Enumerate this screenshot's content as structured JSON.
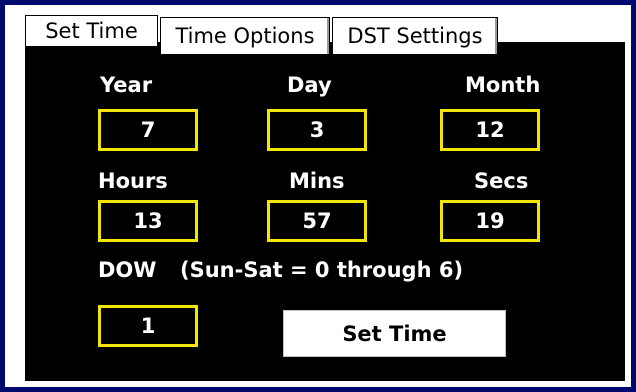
{
  "tabs": [
    {
      "label": "Set Time",
      "active": true
    },
    {
      "label": "Time Options",
      "active": false
    },
    {
      "label": "DST Settings",
      "active": false
    }
  ],
  "date": {
    "year_label": "Year",
    "year_value": "7",
    "day_label": "Day",
    "day_value": "3",
    "month_label": "Month",
    "month_value": "12"
  },
  "time": {
    "hours_label": "Hours",
    "hours_value": "13",
    "mins_label": "Mins",
    "mins_value": "57",
    "secs_label": "Secs",
    "secs_value": "19"
  },
  "dow": {
    "label": "DOW",
    "hint": "(Sun-Sat = 0 through 6)",
    "value": "1"
  },
  "set_button_label": "Set Time",
  "colors": {
    "background": "#000a6e",
    "panel": "#000000",
    "field_border": "#f2e600",
    "text": "#ffffff"
  }
}
